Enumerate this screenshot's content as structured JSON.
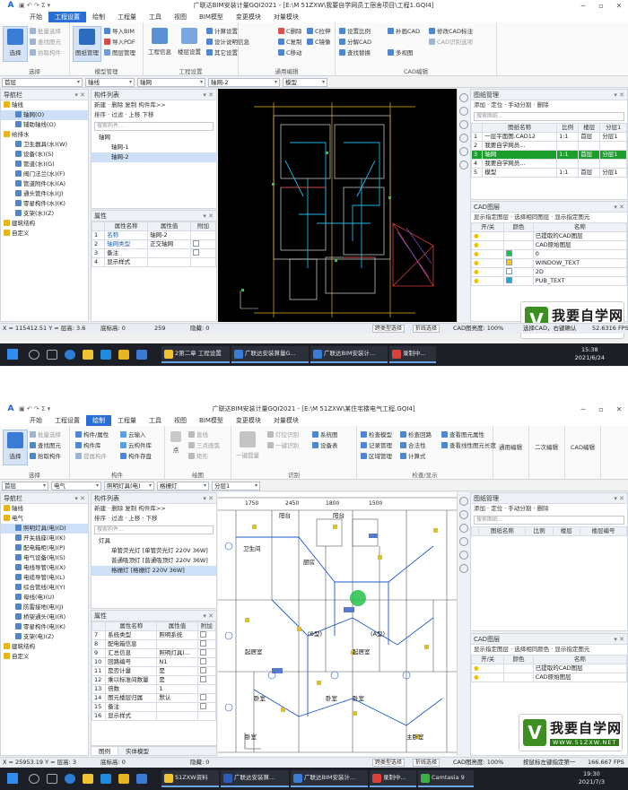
{
  "s1": {
    "title": "广联达BIM安装计量GQI2021 - [E:\\M 51ZXW\\我要自学网员工宿舍项目\\工程1.GQI4]",
    "menu": [
      "开始",
      "工程设置",
      "绘制",
      "工程量",
      "工具",
      "视图",
      "BIM模型",
      "变更模块",
      "对量模块"
    ],
    "menu_active": "工程设置",
    "ribbon": {
      "select": "选择",
      "pick_cad": "批量选择",
      "find_elem": "查找图元",
      "pick_member": "拾取构件",
      "drawing_mgmt": "图纸管理",
      "import_bim": "导入BIM",
      "import_pdf": "导入PDF",
      "layer_mgmt": "图层管理",
      "proj_info": "工程信息",
      "floor_setting": "楼层设置",
      "calc_setting": "计算设置",
      "design_desc": "设计说明信息",
      "other_setting": "其它设置",
      "c_delete": "C删除",
      "c_copy": "C复制",
      "c_move": "C移动",
      "c_stretch": "C拉伸",
      "c_mirror": "C镜像",
      "set_ratio": "设置比例",
      "split_cad": "分解CAD",
      "find_replace": "查找替换",
      "add_cad": "补画CAD",
      "modify_cad_mark": "修改CAD标注",
      "cad_recognize": "CAD识别选项",
      "multi_view": "多视图",
      "g_select": "选择",
      "g_drawing": "图纸管理",
      "g_model": "模型管理",
      "g_setting": "工程设置",
      "g_general": "通用编辑",
      "g_cad": "CAD编辑"
    },
    "dropdowns": [
      "首层",
      "轴线",
      "轴网",
      "轴网-2",
      "模型"
    ],
    "nav_title": "导航栏",
    "nav": [
      {
        "label": "轴线",
        "level": 0,
        "open": true
      },
      {
        "label": "轴网(O)",
        "level": 1,
        "sel": true
      },
      {
        "label": "辅助轴线(O)",
        "level": 1
      },
      {
        "label": "给排水",
        "level": 0,
        "open": true
      },
      {
        "label": "卫生器具(水)(W)",
        "level": 1
      },
      {
        "label": "设备(水)(S)",
        "level": 1
      },
      {
        "label": "管道(水)(G)",
        "level": 1
      },
      {
        "label": "阀门法兰(水)(F)",
        "level": 1
      },
      {
        "label": "管道附件(水)(A)",
        "level": 1
      },
      {
        "label": "通头管件(水)(J)",
        "level": 1
      },
      {
        "label": "零星构件(水)(K)",
        "level": 1
      },
      {
        "label": "支架(水)(Z)",
        "level": 1
      },
      {
        "label": "建筑结构",
        "level": 0
      },
      {
        "label": "自定义",
        "level": 0
      }
    ],
    "list_title": "构件列表",
    "list_toolbar": "新建 · 删除 复制 构件库>>",
    "list_toolbar2": "排序 · 过滤 · 上移 下移",
    "search_ph": "搜索构件...",
    "list": [
      {
        "label": "轴网",
        "level": 0
      },
      {
        "label": "轴网-1",
        "level": 1
      },
      {
        "label": "轴网-2",
        "level": 1,
        "sel": true
      }
    ],
    "prop_title": "属性",
    "prop_head": [
      "属性名称",
      "属性值",
      "附加"
    ],
    "props": [
      [
        "1",
        "名称",
        "轴网-2",
        ""
      ],
      [
        "2",
        "轴网类型",
        "正交轴网",
        "cb"
      ],
      [
        "3",
        "备注",
        "",
        "cb"
      ],
      [
        "4",
        "显示样式",
        "",
        ""
      ]
    ],
    "right_title": "图纸管理",
    "right_toolbar": "添加 · 定位 · 手动分割 · 删除",
    "right_search": "搜索图纸...",
    "dw_head": [
      "图纸名称",
      "比例",
      "楼层",
      "分层1"
    ],
    "dw_rows": [
      [
        "1",
        "一层平面图.CAD12",
        "1:1",
        "首层",
        "分层1"
      ],
      [
        "2",
        "我要自学网员...",
        "",
        "",
        ""
      ],
      [
        "3",
        "轴网",
        "1:1",
        "首层",
        "分层1"
      ],
      [
        "4",
        "我要自学网员...",
        "",
        "",
        ""
      ],
      [
        "5",
        "模型",
        "1:1",
        "首层",
        "分层1"
      ]
    ],
    "layer_title": "CAD图层",
    "layer_toolbar": "显示指定图层 · 选择相同图层 · 显示指定图元",
    "layer_head": [
      "开/关",
      "颜色",
      "名称"
    ],
    "layers": [
      "已提取的CAD图层",
      "CAD原始图层",
      "0",
      "WINDOW_TEXT",
      "2D",
      "PUB_TEXT"
    ],
    "status": {
      "coord": "X = 115412.51 Y = 层高: 3.6",
      "ground": "底标高: 0",
      "count": "259",
      "hidden": "隐藏: 0",
      "cross": "跨类型选择",
      "fold": "折线选择",
      "cad_bright": "CAD图亮度: 100%",
      "hint": "选择CAD，右键确认",
      "fps": "52.6316 FPS"
    },
    "taskbar": {
      "apps": [
        "2第二章 工程设置",
        "广联达安装算量G...",
        "广联达BIM安装计...",
        "录制中..."
      ],
      "time": "15:38",
      "date": "2021/6/24"
    }
  },
  "s2": {
    "title": "广联达BIM安装计量GQI2021 - [E:\\M 51ZXW\\某住宅楼电气工程.GQI4]",
    "menu": [
      "开始",
      "工程设置",
      "绘制",
      "工程量",
      "工具",
      "视图",
      "BIM模型",
      "变更模块",
      "对量模块"
    ],
    "menu_active": "绘制",
    "ribbon": {
      "select": "选择",
      "pick_cad": "批量选择",
      "find_elem": "查找图元",
      "pick_member": "拾取构件",
      "member_prop": "构件/属性",
      "member_lib": "构件库",
      "extract": "提属构件",
      "cloud_import": "云输入",
      "cloud_lib": "云构件库",
      "member_store": "构件存盘",
      "point": "点",
      "line": "直线",
      "three_arc": "三点画弧",
      "rect": "矩形",
      "one_key": "一键提量",
      "light_pos": "灯控识别",
      "one_key_2": "一键识别",
      "system_chart": "系统图",
      "device": "设备表",
      "check_model": "检查模型",
      "record_mgmt": "记录管理",
      "area_mgmt": "区域管理",
      "check_loop": "检查回路",
      "mark_check": "合法性",
      "calc": "计算式",
      "view_prop": "查看图元属性",
      "view_len": "查看线性图元长度",
      "g_select": "选择",
      "g_member": "构件",
      "g_draw": "绘图",
      "g_identify": "识别",
      "g_check": "检查/显示",
      "g_general": "通用编辑",
      "g_second": "二次编辑",
      "g_cad": "CAD编辑"
    },
    "dropdowns": [
      "首层",
      "电气",
      "照明灯具(电)",
      "格栅灯",
      "分层1"
    ],
    "nav_title": "导航栏",
    "nav": [
      {
        "label": "轴线",
        "level": 0
      },
      {
        "label": "电气",
        "level": 0,
        "open": true
      },
      {
        "label": "照明灯具(电)(D)",
        "level": 1,
        "sel": true
      },
      {
        "label": "开关插座(电)(K)",
        "level": 1
      },
      {
        "label": "配电箱柜(电)(P)",
        "level": 1
      },
      {
        "label": "电气设备(电)(S)",
        "level": 1
      },
      {
        "label": "电线导管(电)(X)",
        "level": 1
      },
      {
        "label": "电缆导管(电)(L)",
        "level": 1
      },
      {
        "label": "综合管线(电)(Y)",
        "level": 1
      },
      {
        "label": "母线(电)(U)",
        "level": 1
      },
      {
        "label": "防雷接地(电)(J)",
        "level": 1
      },
      {
        "label": "桥架通头(电)(R)",
        "level": 1
      },
      {
        "label": "零星构件(电)(K)",
        "level": 1
      },
      {
        "label": "支架(电)(Z)",
        "level": 1
      },
      {
        "label": "建筑结构",
        "level": 0
      },
      {
        "label": "自定义",
        "level": 0
      }
    ],
    "list_title": "构件列表",
    "list_toolbar": "新建 · 删除 复制 构件库>>",
    "list_toolbar2": "排序 · 过滤 · 上移 · 下移",
    "search_ph": "搜索构件...",
    "list": [
      {
        "label": "灯具",
        "level": 0
      },
      {
        "label": "单管荧光灯 [单管荧光灯 220V 36W]",
        "level": 1
      },
      {
        "label": "普通吸顶灯 [普通吸顶灯 220V 36W]",
        "level": 1
      },
      {
        "label": "格栅灯 [格栅灯 220V 36W]",
        "level": 1,
        "sel": true
      }
    ],
    "prop_title": "属性",
    "prop_head": [
      "属性名称",
      "属性值",
      "附加"
    ],
    "props": [
      [
        "7",
        "系统类型",
        "照明系统",
        "cb"
      ],
      [
        "8",
        "配电箱信息",
        "",
        "cb"
      ],
      [
        "9",
        "汇总信息",
        "照明灯具(...",
        "cb"
      ],
      [
        "10",
        "回路编号",
        "N1",
        "cb"
      ],
      [
        "11",
        "是否计量",
        "是",
        "cb"
      ],
      [
        "12",
        "乘以标准间数量",
        "是",
        "cb"
      ],
      [
        "13",
        "倍数",
        "1",
        ""
      ],
      [
        "14",
        "图元楼层归属",
        "默认",
        "cb"
      ],
      [
        "15",
        "备注",
        "",
        "cb"
      ],
      [
        "16",
        "显示样式",
        "",
        ""
      ]
    ],
    "tabs": [
      "图例",
      "实体模型"
    ],
    "right_title": "图纸管理",
    "right_toolbar": "添加 · 定位 · 手动分割 · 删除",
    "right_search": "搜索图纸...",
    "dw_head": [
      "图纸名称",
      "比例",
      "楼层",
      "楼层编号"
    ],
    "layer_title": "CAD图层",
    "layer_toolbar": "显示指定图层 · 选择相同颜色 · 显示指定图元",
    "layer_head": [
      "开/关",
      "颜色",
      "名称"
    ],
    "layers": [
      "已提取的CAD图层",
      "CAD原始图层"
    ],
    "dims": [
      "1750",
      "2450",
      "1800",
      "1500"
    ],
    "rooms": [
      "阳台",
      "阳台",
      "卫生间",
      "厨房",
      "起居室",
      "起居室",
      "卧室",
      "卧室",
      "卧室",
      "卧室",
      "主卧室",
      "(B型)",
      "(A型)"
    ],
    "status": {
      "coord": "X = 25953.19 Y = 层高: 3",
      "ground": "底标高: 0",
      "hidden": "隐藏: 0",
      "cross": "跨类型选择",
      "fold": "折线选择",
      "cad_bright": "CAD图亮度: 100%",
      "hint": "按鼠标左键指定第一",
      "fps": "166.667 FPS"
    },
    "taskbar": {
      "apps": [
        "51ZXW资料",
        "广联达安装算...",
        "广联达BIM安装计...",
        "录制中...",
        "Camtasia 9"
      ],
      "time": "19:30",
      "date": "2021/7/3"
    }
  },
  "watermark": {
    "brand": "我要自学网",
    "url": "WWW.51ZXW.NET",
    "v": "V"
  },
  "colors": {
    "accent": "#2a6fd6",
    "cad_bg": "#000000",
    "green_row": "#1c9e2b"
  }
}
